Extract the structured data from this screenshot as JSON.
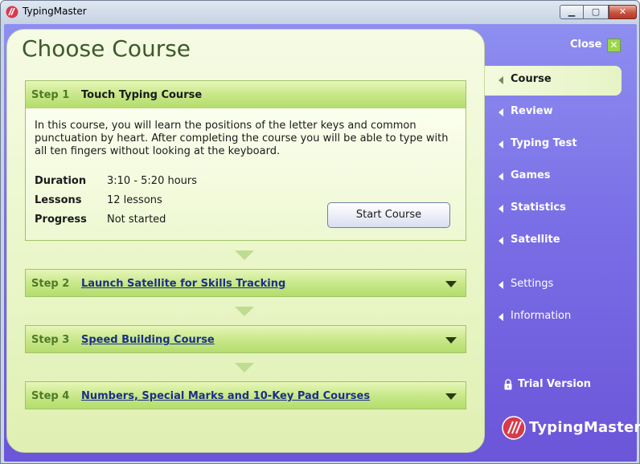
{
  "window": {
    "title": "TypingMaster",
    "minimize_glyph": "▁",
    "maximize_glyph": "▢",
    "close_glyph": "✕"
  },
  "page": {
    "title": "Choose Course",
    "close_label": "Close"
  },
  "steps": [
    {
      "number": "Step 1",
      "name": "Touch Typing Course",
      "description": "In this course, you will learn the positions of the letter keys and common punctuation by heart. After completing the course you will be able to type with all ten fingers without looking at the keyboard.",
      "details": [
        {
          "label": "Duration",
          "value": "3:10 - 5:20 hours"
        },
        {
          "label": "Lessons",
          "value": "12 lessons"
        },
        {
          "label": "Progress",
          "value": "Not started"
        }
      ],
      "button": "Start Course"
    },
    {
      "number": "Step 2",
      "name": "Launch Satellite for Skills Tracking"
    },
    {
      "number": "Step 3",
      "name": "Speed Building Course"
    },
    {
      "number": "Step 4",
      "name": "Numbers, Special Marks and 10-Key Pad Courses"
    }
  ],
  "nav": {
    "items": [
      "Course",
      "Review",
      "Typing Test",
      "Games",
      "Statistics",
      "Satellite"
    ],
    "secondary": [
      "Settings",
      "Information"
    ],
    "active": "Course"
  },
  "footer": {
    "trial": "Trial Version",
    "brand": "TypingMaster"
  },
  "colors": {
    "panel": "#eaf6c9",
    "sidebar": "#7a6fe6",
    "accent": "#9bd648"
  }
}
